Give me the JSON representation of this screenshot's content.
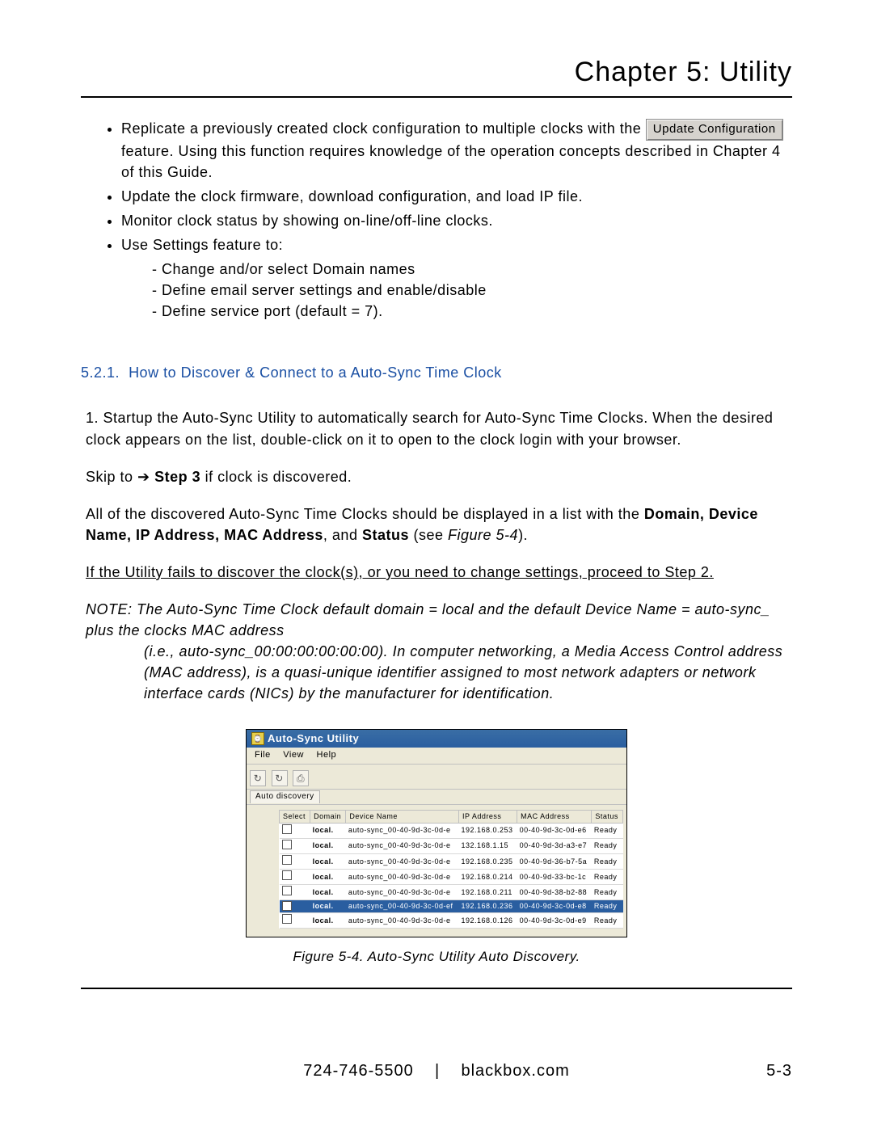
{
  "chapter_title": "Chapter 5: Utility",
  "bullets": [
    {
      "pre": "Replicate a previously created clock configuration to multiple clocks with the ",
      "button": "Update Configuration",
      "post": " feature. Using this function requires knowledge of the operation concepts described in Chapter 4 of this Guide."
    },
    {
      "text": "Update the clock firmware, download configuration, and load IP file."
    },
    {
      "text": "Monitor clock status by showing on-line/off-line clocks."
    },
    {
      "text": "Use Settings feature to:",
      "sub": [
        "Change and/or select Domain names",
        "Define email server settings and enable/disable",
        "Define service port (default = 7)."
      ]
    }
  ],
  "section_number": "5.2.1.",
  "section_title": "How to Discover & Connect to a Auto-Sync Time Clock",
  "step1": "1. Startup the Auto-Sync Utility to automatically search for Auto-Sync Time Clocks. When the desired clock appears on the list, double-click on it to open to the clock login with your browser.",
  "skip_line_prefix": "Skip to ",
  "skip_line_arrow": "➔",
  "skip_line_bold": "Step 3",
  "skip_line_suffix": " if clock is discovered.",
  "para_all_1": "All of the discovered Auto-Sync Time Clocks should be displayed in a list with the ",
  "para_all_bold": "Domain, Device Name, IP Address, MAC Address",
  "para_all_2": ", and ",
  "para_all_bold2": "Status",
  "para_all_3": " (see ",
  "para_all_fig": "Figure 5-4",
  "para_all_4": ").",
  "underline_text": "If the Utility fails to discover the clock(s), or you need to change settings, proceed to Step 2.",
  "note_prefix": "NOTE: ",
  "note_l1": "The Auto-Sync Time Clock default domain = local and the default Device Name = auto-sync_ plus the clocks MAC address",
  "note_l2": "(i.e., auto-sync_00:00:00:00:00:00). In computer networking, a Media Access Control address (MAC address), is a quasi-unique identifier assigned to most network adapters or network interface cards (NICs) by the manufacturer for identification.",
  "shot": {
    "title": "Auto-Sync Utility",
    "menus": [
      "File",
      "View",
      "Help"
    ],
    "toolbar_icons": [
      "refresh-icon",
      "refresh-all-icon",
      "print-icon"
    ],
    "tab": "Auto discovery",
    "columns": [
      "Select",
      "Domain",
      "Device Name",
      "IP Address",
      "MAC Address",
      "Status"
    ],
    "rows": [
      {
        "sel": false,
        "domain": "local.",
        "dev": "auto-sync_00-40-9d-3c-0d-e",
        "ip": "192.168.0.253",
        "mac": "00-40-9d-3c-0d-e6",
        "status": "Ready"
      },
      {
        "sel": false,
        "domain": "local.",
        "dev": "auto-sync_00-40-9d-3c-0d-e",
        "ip": "132.168.1.15",
        "mac": "00-40-9d-3d-a3-e7",
        "status": "Ready"
      },
      {
        "sel": false,
        "domain": "local.",
        "dev": "auto-sync_00-40-9d-3c-0d-e",
        "ip": "192.168.0.235",
        "mac": "00-40-9d-36-b7-5a",
        "status": "Ready"
      },
      {
        "sel": false,
        "domain": "local.",
        "dev": "auto-sync_00-40-9d-3c-0d-e",
        "ip": "192.168.0.214",
        "mac": "00-40-9d-33-bc-1c",
        "status": "Ready"
      },
      {
        "sel": false,
        "domain": "local.",
        "dev": "auto-sync_00-40-9d-3c-0d-e",
        "ip": "192.168.0.211",
        "mac": "00-40-9d-38-b2-88",
        "status": "Ready"
      },
      {
        "sel": true,
        "domain": "local.",
        "dev": "auto-sync_00-40-9d-3c-0d-ef",
        "ip": "192.168.0.236",
        "mac": "00-40-9d-3c-0d-e8",
        "status": "Ready"
      },
      {
        "sel": false,
        "domain": "local.",
        "dev": "auto-sync_00-40-9d-3c-0d-e",
        "ip": "192.168.0.126",
        "mac": "00-40-9d-3c-0d-e9",
        "status": "Ready"
      }
    ]
  },
  "caption": "Figure 5-4. Auto-Sync Utility Auto Discovery.",
  "footer_phone": "724-746-5500",
  "footer_divider": "|",
  "footer_site": "blackbox.com",
  "page_number": "5-3"
}
